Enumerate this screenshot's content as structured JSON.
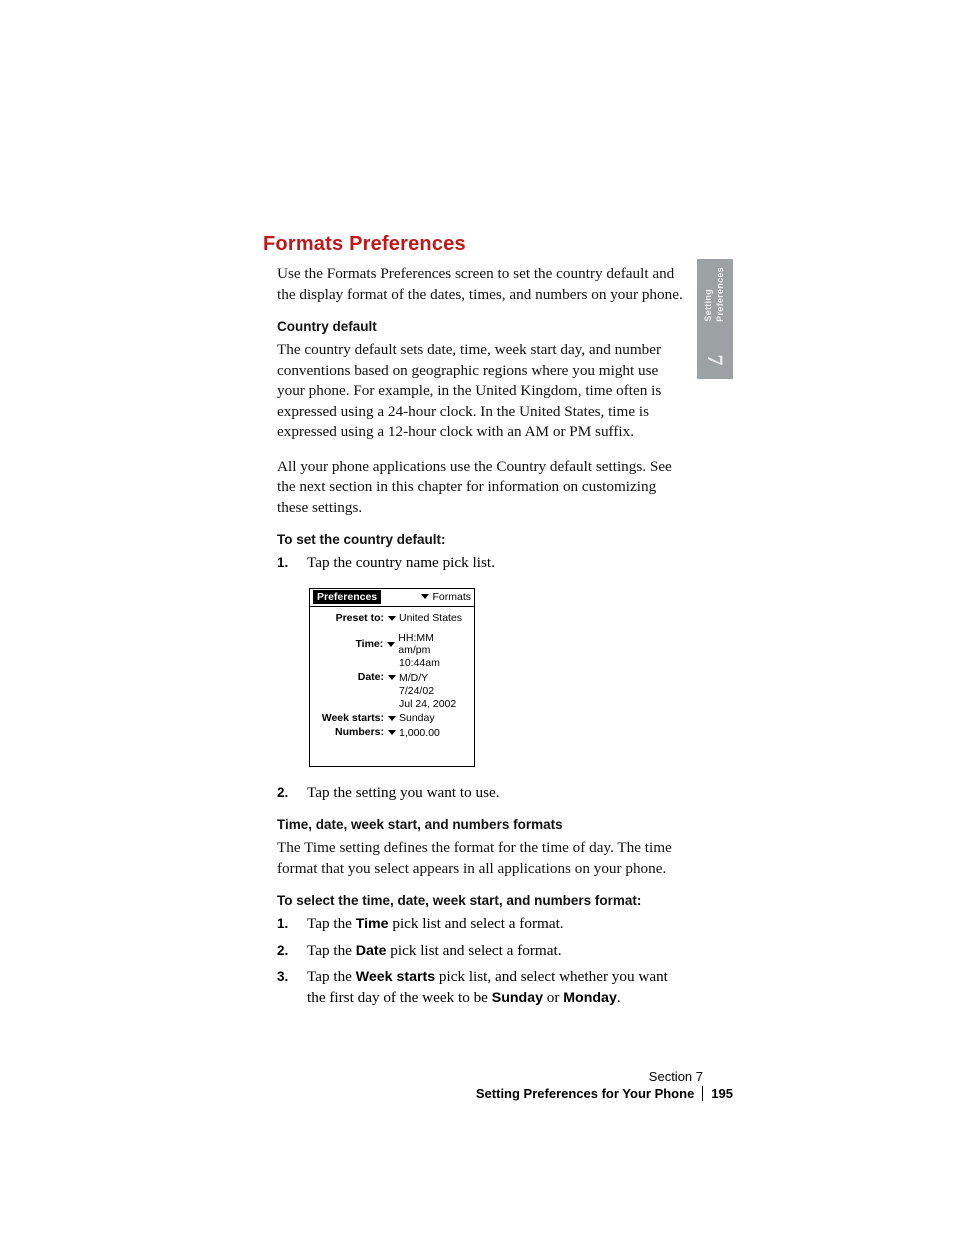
{
  "heading": "Formats Preferences",
  "intro": "Use the Formats Preferences screen to set the country default and the display format of the dates, times, and numbers on your phone.",
  "sub_country": "Country default",
  "country_p1": "The country default sets date, time, week start day, and number conventions based on geographic regions where you might use your phone. For example, in the United Kingdom, time often is expressed using a 24-hour clock. In the United States, time is expressed using a 12-hour clock with an AM or PM suffix.",
  "country_p2": "All your phone applications use the Country default settings. See the next section in this chapter for information on customizing these settings.",
  "sub_set_country": "To set the country default:",
  "steps_country": {
    "s1": "Tap the country name pick list."
  },
  "palm": {
    "title_left": "Preferences",
    "title_right": "Formats",
    "preset_label": "Preset to:",
    "preset_val": "United States",
    "time_label": "Time:",
    "time_val": "HH:MM am/pm",
    "time_example": "10:44am",
    "date_label": "Date:",
    "date_val": "M/D/Y",
    "date_ex1": "7/24/02",
    "date_ex2": "Jul 24, 2002",
    "week_label": "Week starts:",
    "week_val": "Sunday",
    "num_label": "Numbers:",
    "num_val": "1,000.00"
  },
  "steps_country2": {
    "s2": "Tap the setting you want to use."
  },
  "sub_formats": "Time, date, week start, and numbers formats",
  "formats_p": "The Time setting defines the format for the time of day. The time format that you select appears in all applications on your phone.",
  "sub_select": "To select the time, date, week start, and numbers format:",
  "steps_select": {
    "s1a": "Tap the ",
    "s1b": "Time",
    "s1c": " pick list and select a format.",
    "s2a": "Tap the ",
    "s2b": "Date",
    "s2c": " pick list and select a format.",
    "s3a": "Tap the ",
    "s3b": "Week starts",
    "s3c": " pick list, and select whether you want the first day of the week to be ",
    "s3d": "Sunday",
    "s3e": " or ",
    "s3f": "Monday",
    "s3g": "."
  },
  "side": {
    "line1": "Setting",
    "line2": "Preferences",
    "number": "7"
  },
  "footer": {
    "section": "Section 7",
    "title": "Setting Preferences for Your Phone",
    "page": "195"
  }
}
